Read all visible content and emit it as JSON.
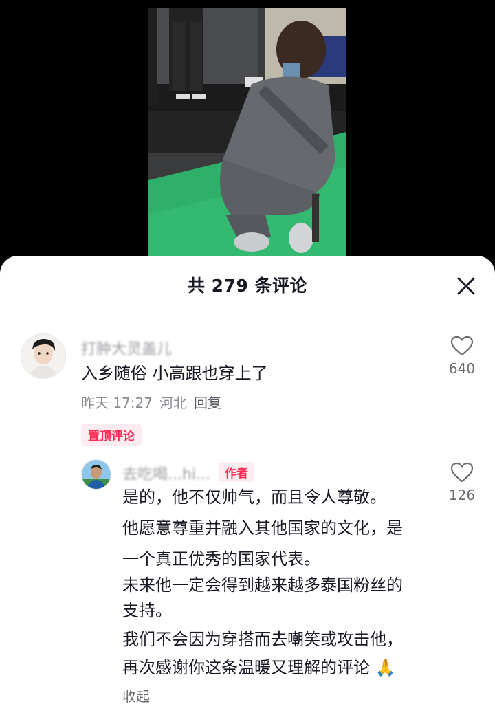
{
  "header": {
    "title": "共 279 条评论"
  },
  "comments": [
    {
      "username": "打肿大灵盖儿",
      "text": "入乡随俗 小高跟也穿上了",
      "time": "昨天 17:27",
      "location": "河北",
      "reply_label": "回复",
      "likes": "640",
      "pin_label": "置顶评论"
    }
  ],
  "reply": {
    "username": "去吃喝...hi...",
    "author_badge": "作者",
    "likes": "126",
    "lines": [
      "是的，他不仅帅气，而且令人尊敬。",
      "他愿意尊重并融入其他国家的文化，是",
      "一个真正优秀的国家代表。",
      "未来他一定会得到越来越多泰国粉丝的",
      "支持。",
      "我们不会因为穿搭而去嘲笑或攻击他，",
      "再次感谢你这条温暖又理解的评论"
    ],
    "emoji": "🙏",
    "collapse_label": "收起"
  },
  "colors": {
    "accent": "#fe2c55",
    "text": "#161823",
    "muted": "#8a8b91",
    "badge_bg": "#fdecef"
  },
  "icons": {
    "close": "close-icon",
    "like": "heart-outline-icon"
  }
}
